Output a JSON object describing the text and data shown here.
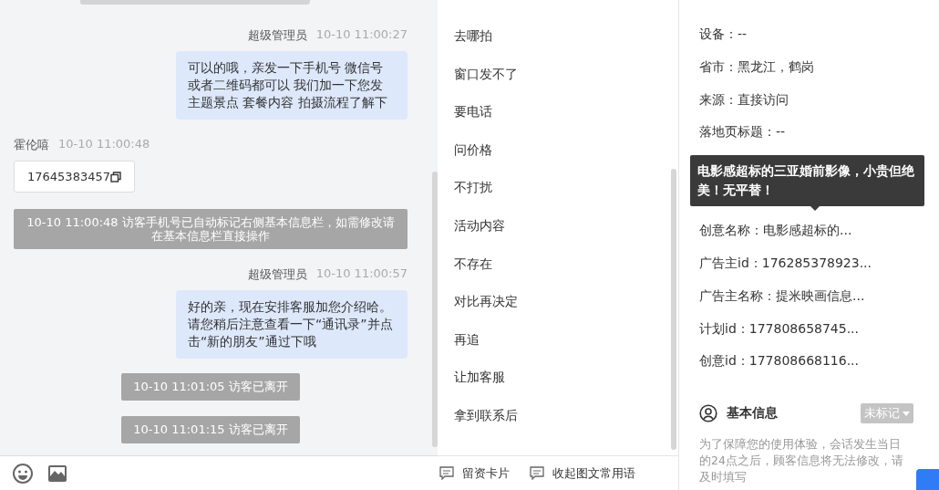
{
  "chat": {
    "messages": [
      {
        "kind": "agent",
        "sender": "超级管理员",
        "time": "10-10 11:00:27",
        "text": "可以的哦，亲发一下手机号 微信号或者二维码都可以 我们加一下您发主题景点 套餐内容 拍摄流程了解下"
      },
      {
        "kind": "visitor",
        "sender": "霍伦嘻",
        "time": "10-10 11:00:48",
        "text": "17645383457"
      },
      {
        "kind": "system",
        "text": "10-10 11:00:48 访客手机号已自动标记右侧基本信息栏，如需修改请在基本信息栏直接操作"
      },
      {
        "kind": "agent",
        "sender": "超级管理员",
        "time": "10-10 11:00:57",
        "text": "好的亲，现在安排客服加您介绍哈。请您稍后注意查看一下“通讯录”并点击“新的朋友”通过下哦"
      },
      {
        "kind": "event",
        "text": "10-10 11:01:05 访客已离开"
      },
      {
        "kind": "event",
        "text": "10-10 11:01:15 访客已离开"
      }
    ]
  },
  "quick_replies": {
    "items": [
      "去哪拍",
      "窗口发不了",
      "要电话",
      "问价格",
      "不打扰",
      "活动内容",
      "不存在",
      "对比再决定",
      "再追",
      "让加客服",
      "拿到联系后"
    ],
    "buttons": [
      {
        "label": "留资卡片"
      },
      {
        "label": "收起图文常用语"
      }
    ]
  },
  "source_info": {
    "fields": [
      "设备：--",
      "省市：黑龙江，鹤岗",
      "来源：直接访问",
      "落地页标题：--",
      "创意名称：电影感超标的...",
      "广告主id：176285378923...",
      "广告主名称：提米映画信息...",
      "计划id：177808658745...",
      "创意id：177808668116..."
    ],
    "tooltip": "电影感超标的三亚婚前影像，小贵但绝美！无平替！"
  },
  "basic_info": {
    "title": "基本信息",
    "tag": "未标记",
    "note": "为了保障您的使用体验，会话发生当日的24点之后，顾客信息将无法修改，请及时填写"
  }
}
